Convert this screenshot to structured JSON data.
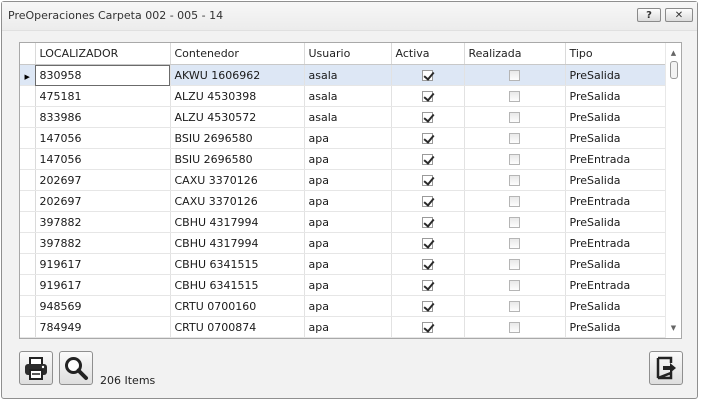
{
  "window": {
    "title": "PreOperaciones Carpeta 002 - 005 - 14",
    "help_label": "?",
    "close_label": "✕"
  },
  "grid": {
    "columns": [
      "LOCALIZADOR",
      "Contenedor",
      "Usuario",
      "Activa",
      "Realizada",
      "Tipo"
    ],
    "row_indicator": "▶",
    "rows": [
      {
        "localizador": "830958",
        "contenedor": "AKWU 1606962",
        "usuario": "asala",
        "activa": true,
        "realizada": false,
        "tipo": "PreSalida",
        "selected": true
      },
      {
        "localizador": "475181",
        "contenedor": "ALZU 4530398",
        "usuario": "asala",
        "activa": true,
        "realizada": false,
        "tipo": "PreSalida"
      },
      {
        "localizador": "833986",
        "contenedor": "ALZU 4530572",
        "usuario": "asala",
        "activa": true,
        "realizada": false,
        "tipo": "PreSalida"
      },
      {
        "localizador": "147056",
        "contenedor": "BSIU 2696580",
        "usuario": "apa",
        "activa": true,
        "realizada": false,
        "tipo": "PreSalida"
      },
      {
        "localizador": "147056",
        "contenedor": "BSIU 2696580",
        "usuario": "apa",
        "activa": true,
        "realizada": false,
        "tipo": "PreEntrada"
      },
      {
        "localizador": "202697",
        "contenedor": "CAXU 3370126",
        "usuario": "apa",
        "activa": true,
        "realizada": false,
        "tipo": "PreSalida"
      },
      {
        "localizador": "202697",
        "contenedor": "CAXU 3370126",
        "usuario": "apa",
        "activa": true,
        "realizada": false,
        "tipo": "PreEntrada"
      },
      {
        "localizador": "397882",
        "contenedor": "CBHU 4317994",
        "usuario": "apa",
        "activa": true,
        "realizada": false,
        "tipo": "PreSalida"
      },
      {
        "localizador": "397882",
        "contenedor": "CBHU 4317994",
        "usuario": "apa",
        "activa": true,
        "realizada": false,
        "tipo": "PreEntrada"
      },
      {
        "localizador": "919617",
        "contenedor": "CBHU 6341515",
        "usuario": "apa",
        "activa": true,
        "realizada": false,
        "tipo": "PreSalida"
      },
      {
        "localizador": "919617",
        "contenedor": "CBHU 6341515",
        "usuario": "apa",
        "activa": true,
        "realizada": false,
        "tipo": "PreEntrada"
      },
      {
        "localizador": "948569",
        "contenedor": "CRTU 0700160",
        "usuario": "apa",
        "activa": true,
        "realizada": false,
        "tipo": "PreSalida"
      },
      {
        "localizador": "784949",
        "contenedor": "CRTU 0700874",
        "usuario": "apa",
        "activa": true,
        "realizada": false,
        "tipo": "PreSalida"
      }
    ]
  },
  "footer": {
    "item_count": "206 Items",
    "icons": {
      "print": "printer-icon",
      "search": "magnifier-icon",
      "exit": "exit-icon"
    }
  }
}
